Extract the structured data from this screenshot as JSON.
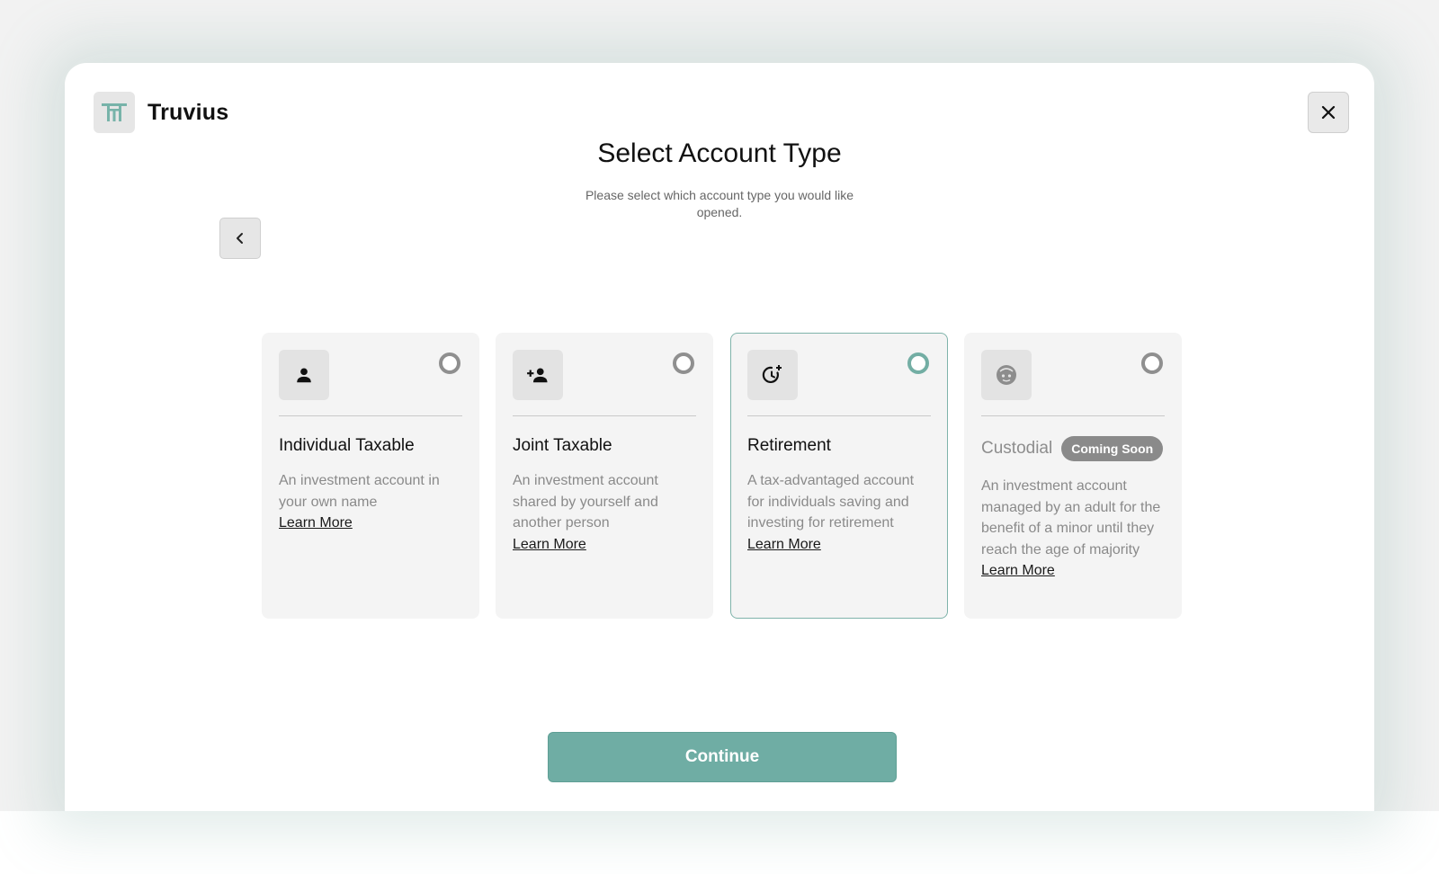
{
  "app": {
    "name": "Truvius"
  },
  "header": {
    "title": "Select Account Type",
    "subtitle": "Please select which account type you would like opened."
  },
  "nav": {
    "close_icon": "close-icon",
    "back_icon": "chevron-left-icon"
  },
  "cards": [
    {
      "title": "Individual Taxable",
      "description": "An investment account in your own name",
      "link": "Learn More",
      "icon": "person-icon",
      "selected": false
    },
    {
      "title": "Joint Taxable",
      "description": "An investment account shared by yourself and another person",
      "link": "Learn More",
      "icon": "person-add-icon",
      "selected": false
    },
    {
      "title": "Retirement",
      "description": "A tax-advantaged account for individuals saving and investing for retirement",
      "link": "Learn More",
      "icon": "retirement-clock-icon",
      "selected": true
    },
    {
      "title": "Custodial",
      "badge": "Coming Soon",
      "description": "An investment account managed by an adult for the benefit of a minor until they reach the age of majority",
      "link": "Learn More",
      "icon": "child-face-icon",
      "disabled": true
    }
  ],
  "footer": {
    "continue_label": "Continue"
  },
  "colors": {
    "accent": "#6fada4",
    "selected_border": "#7fb3aa",
    "card_bg": "#f4f4f4",
    "badge_bg": "#8a8a8a"
  }
}
